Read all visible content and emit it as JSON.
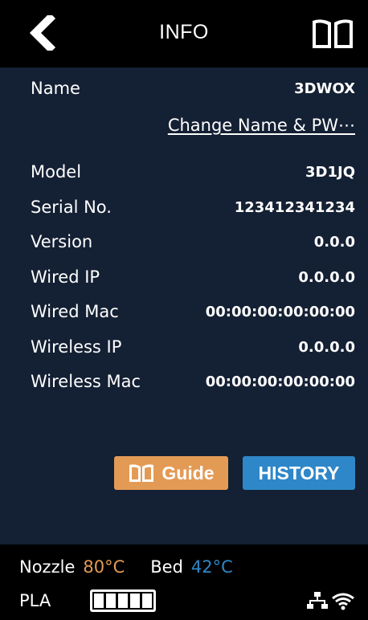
{
  "header": {
    "title": "INFO",
    "back_icon": "chevron-left-icon",
    "manual_icon": "open-book-icon"
  },
  "info": {
    "name_label": "Name",
    "name_value": "3DWOX",
    "change_link": "Change Name & PW⋯",
    "rows": [
      {
        "label": "Model",
        "value": "3D1JQ"
      },
      {
        "label": "Serial No.",
        "value": "123412341234"
      },
      {
        "label": "Version",
        "value": "0.0.0"
      },
      {
        "label": "Wired IP",
        "value": "0.0.0.0"
      },
      {
        "label": "Wired Mac",
        "value": "00:00:00:00:00:00"
      },
      {
        "label": "Wireless IP",
        "value": "0.0.0.0"
      },
      {
        "label": "Wireless Mac",
        "value": "00:00:00:00:00:00"
      }
    ]
  },
  "buttons": {
    "guide_label": "Guide",
    "history_label": "HISTORY"
  },
  "status": {
    "nozzle_label": "Nozzle",
    "nozzle_temp": "80°C",
    "bed_label": "Bed",
    "bed_temp": "42°C",
    "material": "PLA",
    "filament_level_segments": 5,
    "filament_level_filled": 5
  },
  "colors": {
    "background": "#142033",
    "header_footer": "#000000",
    "nozzle_accent": "#e39a55",
    "bed_accent": "#2e87c8"
  }
}
